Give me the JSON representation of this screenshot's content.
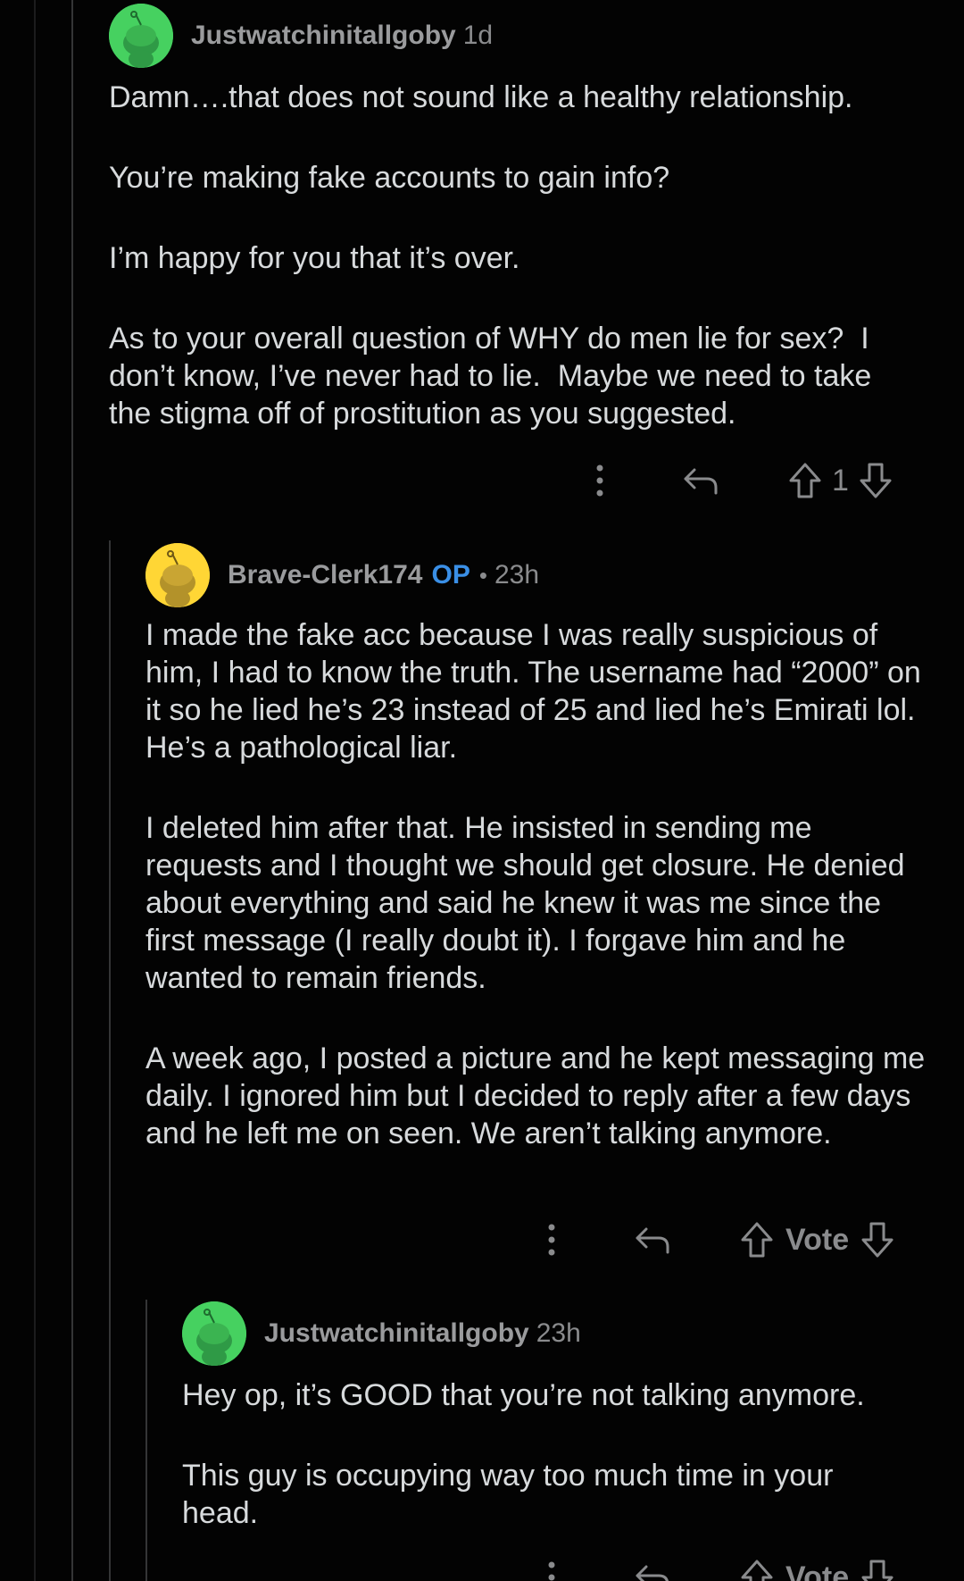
{
  "comments": [
    {
      "username": "Justwatchinitallgoby",
      "time": "1d",
      "avatar_color": "#46d160",
      "paragraphs": [
        "Damn….that does not sound like a healthy relationship.",
        "You’re making fake accounts to gain info?",
        "I’m happy for you that it’s over.",
        "As to your overall question of WHY do men lie for sex?  I don’t know, I’ve never had to lie.  Maybe we need to take the stigma off of prostitution as you suggested."
      ],
      "score": "1",
      "icons": {
        "more": "more-vertical-icon",
        "reply": "reply-icon",
        "upvote": "upvote-arrow-icon",
        "downvote": "downvote-arrow-icon"
      }
    },
    {
      "username": "Brave-Clerk174",
      "op_badge": "OP",
      "separator": "•",
      "time": "23h",
      "avatar_color": "#ffd635",
      "paragraphs": [
        "I made the fake acc because I was really suspicious of him, I had to know the truth. The username had “2000” on it so he lied he’s 23 instead of 25 and lied he’s Emirati lol. He’s a pathological liar.",
        "I deleted him after that. He insisted in sending me requests and I thought we should get closure. He denied about everything and said he knew it was me since the first message (I really doubt it). I forgave him and he wanted to remain friends.",
        "A week ago, I posted a picture and he kept messaging me daily. I ignored him but I decided to reply after a few days and he left me on seen. We aren’t talking anymore."
      ],
      "score": "Vote"
    },
    {
      "username": "Justwatchinitallgoby",
      "time": "23h",
      "avatar_color": "#46d160",
      "paragraphs": [
        "Hey op, it’s GOOD that you’re not talking anymore.",
        "This guy is occupying way too much time in your head."
      ],
      "score": "Vote"
    }
  ],
  "colors": {
    "background": "#030303",
    "text": "#d7dadc",
    "meta": "#8a8b8d",
    "op": "#3a8fe6",
    "thread_line": "#343536"
  }
}
